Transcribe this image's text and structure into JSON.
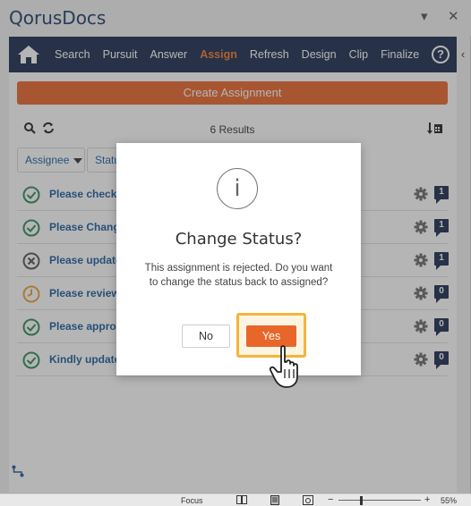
{
  "app": {
    "title": "QorusDocs"
  },
  "titlebar": {
    "dropdown_icon": "chevron-down-icon",
    "close_icon": "close-icon"
  },
  "nav": {
    "home_icon": "home-icon",
    "items": [
      {
        "label": "Search",
        "active": false
      },
      {
        "label": "Pursuit",
        "active": false
      },
      {
        "label": "Answer",
        "active": false
      },
      {
        "label": "Assign",
        "active": true
      },
      {
        "label": "Refresh",
        "active": false
      },
      {
        "label": "Design",
        "active": false
      },
      {
        "label": "Clip",
        "active": false
      },
      {
        "label": "Finalize",
        "active": false
      }
    ],
    "help_label": "?",
    "accent_color": "#f07a2a",
    "bar_color": "#1a2c4f"
  },
  "main": {
    "create_button": "Create Assignment",
    "results_text": "6 Results",
    "filters": {
      "assignee": "Assignee",
      "status": "Status"
    },
    "assignments": [
      {
        "title": "Please check i",
        "status": "completed",
        "count": "1"
      },
      {
        "title": "Please Change",
        "status": "completed",
        "count": "1"
      },
      {
        "title": "Please update",
        "status": "rejected",
        "count": "1"
      },
      {
        "title": "Please review",
        "status": "pending",
        "count": "0"
      },
      {
        "title": "Please approv",
        "status": "completed",
        "count": "0"
      },
      {
        "title": "Kindly update",
        "status": "completed",
        "count": "0"
      }
    ],
    "status_colors": {
      "completed": "#2e8b57",
      "rejected": "#555555",
      "pending": "#e8a33a"
    }
  },
  "dialog": {
    "icon": "info-icon",
    "icon_glyph": "i",
    "title": "Change Status?",
    "message": "This assignment is rejected. Do you want to change the status back to assigned?",
    "no_label": "No",
    "yes_label": "Yes",
    "highlight_color": "#f5b43a"
  },
  "statusbar": {
    "focus_label": "Focus",
    "minus": "−",
    "plus": "+",
    "zoom": "55%"
  }
}
